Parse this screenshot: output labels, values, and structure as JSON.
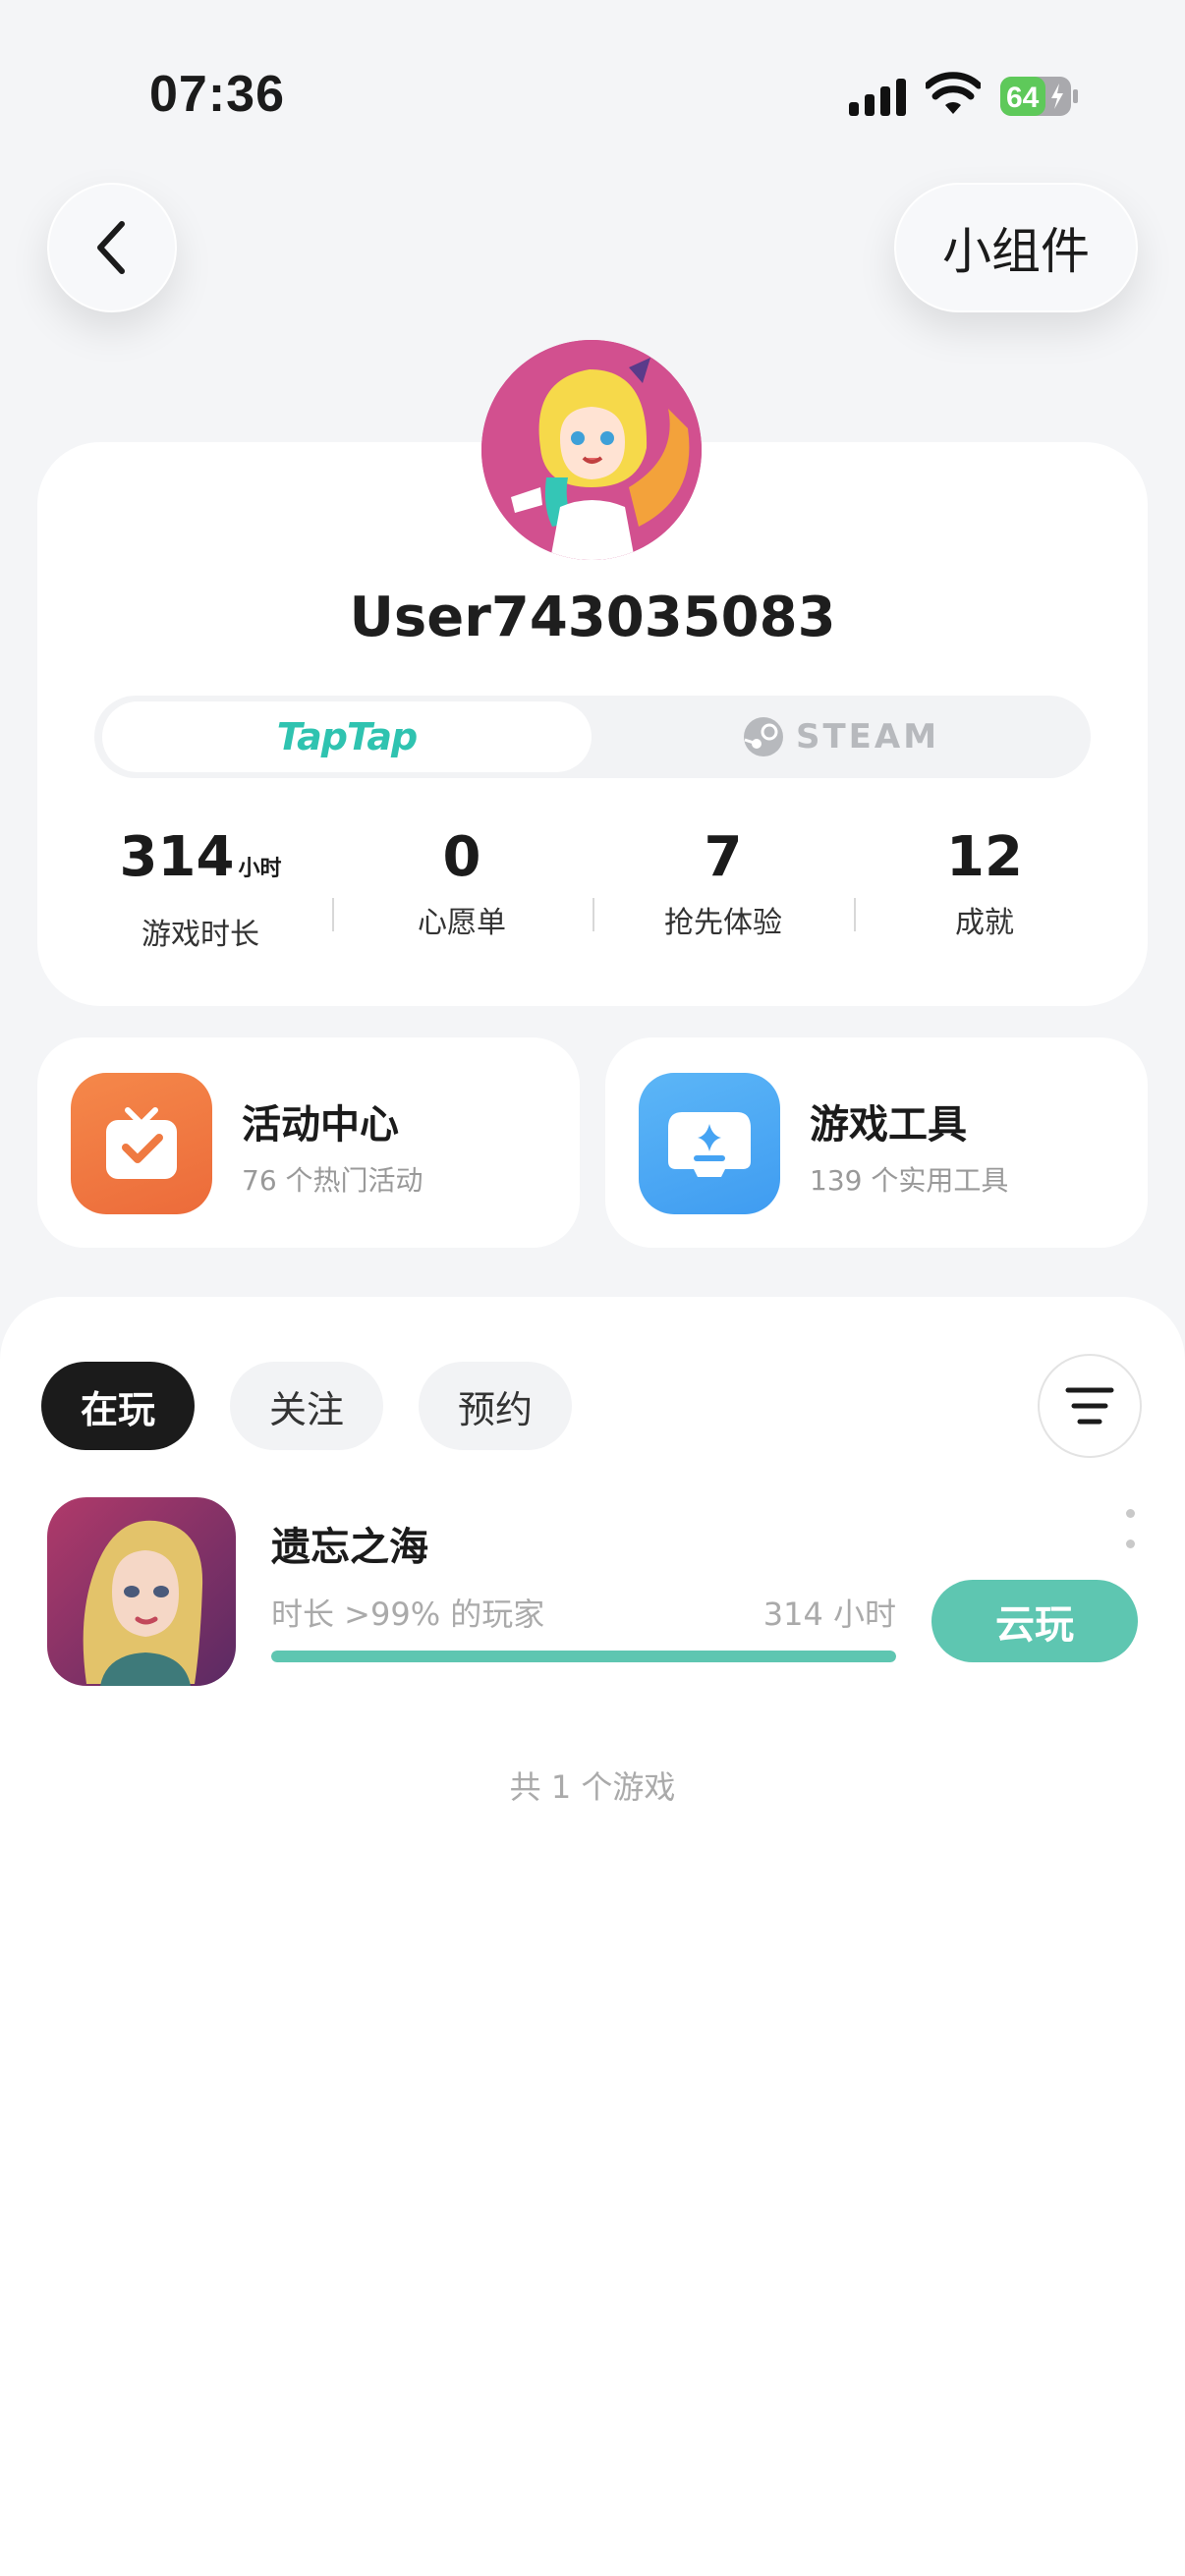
{
  "status_bar": {
    "time": "07:36",
    "battery": "64"
  },
  "header": {
    "widget_button": "小组件"
  },
  "profile": {
    "username": "User743035083",
    "platforms": [
      "TapTap",
      "STEAM"
    ],
    "stats": [
      {
        "value": "314",
        "unit": "小时",
        "label": "游戏时长"
      },
      {
        "value": "0",
        "unit": "",
        "label": "心愿单"
      },
      {
        "value": "7",
        "unit": "",
        "label": "抢先体验"
      },
      {
        "value": "12",
        "unit": "",
        "label": "成就"
      }
    ]
  },
  "features": [
    {
      "title": "活动中心",
      "subtitle": "76 个热门活动",
      "icon": "gift-check-icon",
      "color": "#f07a42"
    },
    {
      "title": "游戏工具",
      "subtitle": "139 个实用工具",
      "icon": "gamepad-icon",
      "color": "#4aa8f5"
    }
  ],
  "tabs": [
    "在玩",
    "关注",
    "预约"
  ],
  "games": [
    {
      "title": "遗忘之海",
      "meta": "时长 >99% 的玩家",
      "hours": "314 小时",
      "progress": 1.0,
      "action": "云玩"
    }
  ],
  "footer": {
    "total": "共 1 个游戏"
  },
  "colors": {
    "accent": "#5ec6b1",
    "taptap": "#2fc3b0"
  }
}
